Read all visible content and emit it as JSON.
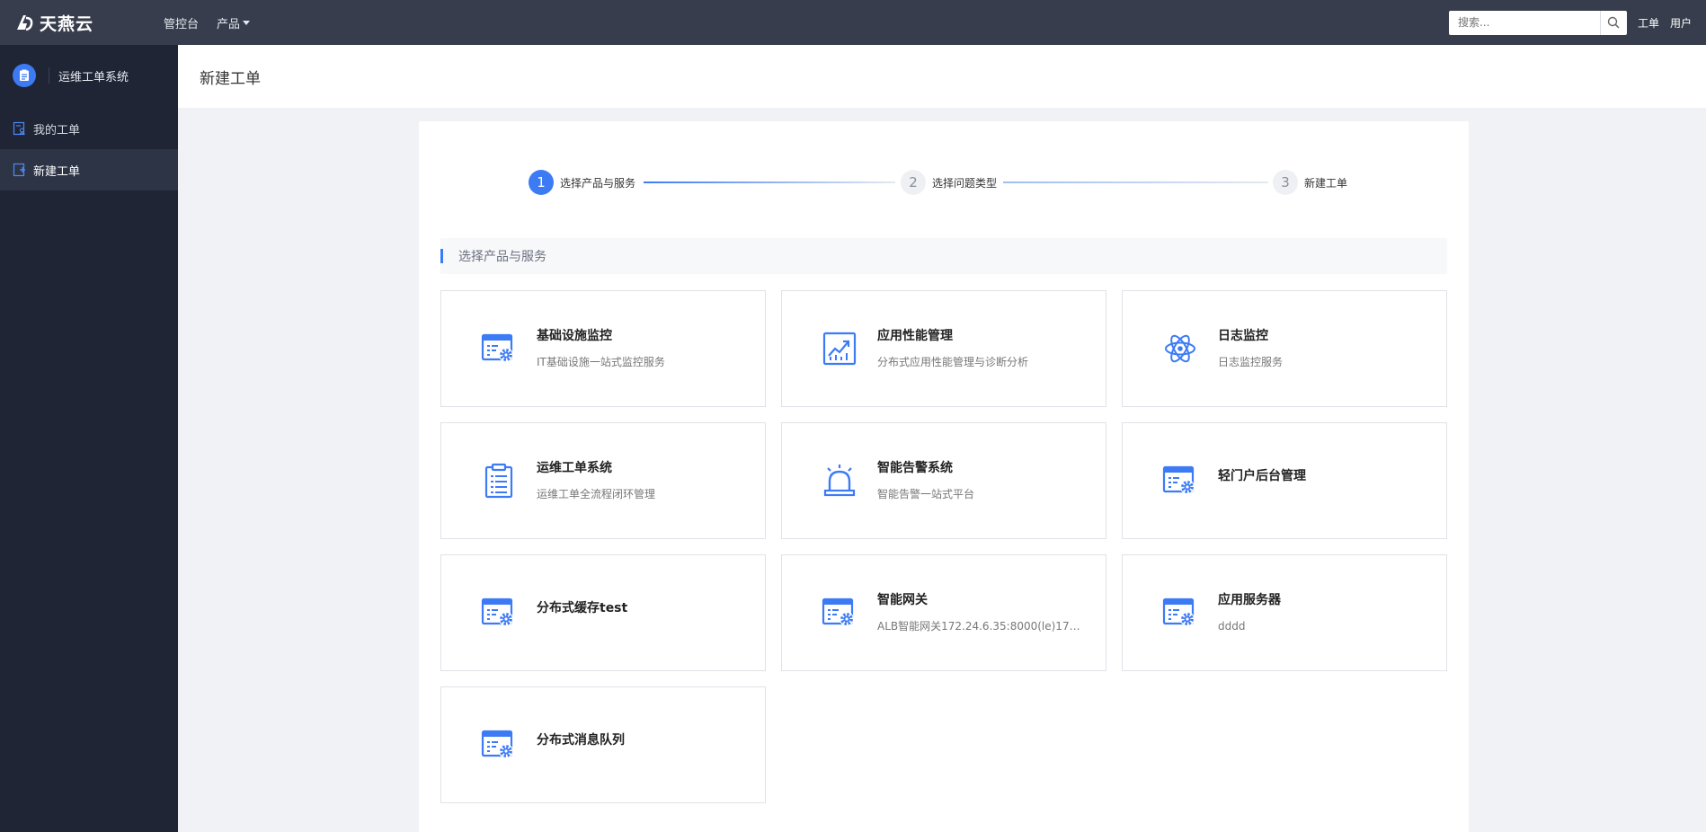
{
  "topbar": {
    "logo_text": "天燕云",
    "nav": [
      {
        "label": "管控台"
      },
      {
        "label": "产品"
      }
    ],
    "search_placeholder": "搜索...",
    "right_items": [
      "工单",
      "用户"
    ]
  },
  "sidebar": {
    "app_name": "运维工单系统",
    "items": [
      {
        "label": "我的工单",
        "active": false,
        "icon": "user-doc-icon"
      },
      {
        "label": "新建工单",
        "active": true,
        "icon": "add-doc-icon"
      }
    ]
  },
  "page": {
    "title": "新建工单"
  },
  "steps": [
    {
      "number": "1",
      "label": "选择产品与服务",
      "active": true
    },
    {
      "number": "2",
      "label": "选择问题类型",
      "active": false
    },
    {
      "number": "3",
      "label": "新建工单",
      "active": false
    }
  ],
  "section_title": "选择产品与服务",
  "products": [
    {
      "title": "基础设施监控",
      "desc": "IT基础设施一站式监控服务",
      "icon": "server-gear-icon"
    },
    {
      "title": "应用性能管理",
      "desc": "分布式应用性能管理与诊断分析",
      "icon": "chart-trend-icon"
    },
    {
      "title": "日志监控",
      "desc": "日志监控服务",
      "icon": "atom-icon"
    },
    {
      "title": "运维工单系统",
      "desc": "运维工单全流程闭环管理",
      "icon": "clipboard-list-icon"
    },
    {
      "title": "智能告警系统",
      "desc": "智能告警一站式平台",
      "icon": "alarm-siren-icon"
    },
    {
      "title": "轻门户后台管理",
      "desc": "",
      "icon": "server-gear-icon"
    },
    {
      "title": "分布式缓存test",
      "desc": "",
      "icon": "server-gear-icon"
    },
    {
      "title": "智能网关",
      "desc": "ALB智能网关172.24.6.35:8000(le)172.2...",
      "icon": "server-gear-icon"
    },
    {
      "title": "应用服务器",
      "desc": "dddd",
      "icon": "server-gear-icon"
    },
    {
      "title": "分布式消息队列",
      "desc": "",
      "icon": "server-gear-icon"
    }
  ],
  "colors": {
    "topbar": "#373d4c",
    "sidebar": "#1f2535",
    "accent": "#3d7bf5"
  }
}
